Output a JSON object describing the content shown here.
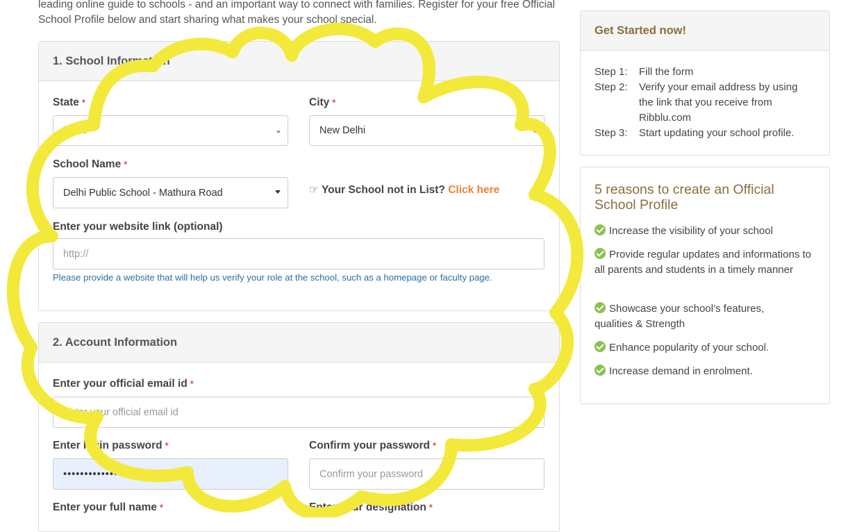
{
  "intro_text": "leading online guide to schools - and an important way to connect with families. Register for your free Official School Profile below and start sharing what makes your school special.",
  "school_section": {
    "title": "1. School Information",
    "state_label": "State",
    "state_value": "Delhi",
    "city_label": "City",
    "city_value": "New Delhi",
    "school_name_label": "School Name",
    "school_name_value": "Delhi Public School - Mathura Road",
    "not_in_list_text": "Your School not in List?",
    "click_here": "Click here",
    "website_label": "Enter your website link (optional)",
    "website_placeholder": "http://",
    "website_help": "Please provide a website that will help us verify your role at the school, such as a homepage or faculty page."
  },
  "account_section": {
    "title": "2. Account Information",
    "email_label": "Enter your official email id",
    "email_placeholder": "Enter your official email id",
    "password_label": "Enter login password",
    "password_value": "••••••••••••••",
    "confirm_label": "Confirm your password",
    "confirm_placeholder": "Confirm your password",
    "fullname_label": "Enter your full name",
    "designation_label": "Enter your designation"
  },
  "required_mark": "*",
  "get_started": {
    "title": "Get Started now!",
    "steps": [
      {
        "key": "Step 1:",
        "text": "Fill the form"
      },
      {
        "key": "Step 2:",
        "text": "Verify your email address by using the link that you receive from Ribblu.com"
      },
      {
        "key": "Step 3:",
        "text": "Start updating your school profile."
      }
    ]
  },
  "reasons": {
    "title": "5 reasons to create an Official School Profile",
    "items": [
      "Increase the visibility of your school",
      "Provide regular updates and informations to all parents and students in a timely manner",
      "Showcase your school’s features, qualities & Strength",
      "Enhance popularity of your school.",
      "Increase demand in enrolment."
    ]
  },
  "colors": {
    "accent_link": "#f0813c",
    "heading_brown": "#8a6d3b",
    "check_green": "#8cc152",
    "highlight_yellow": "#f3e93a"
  }
}
